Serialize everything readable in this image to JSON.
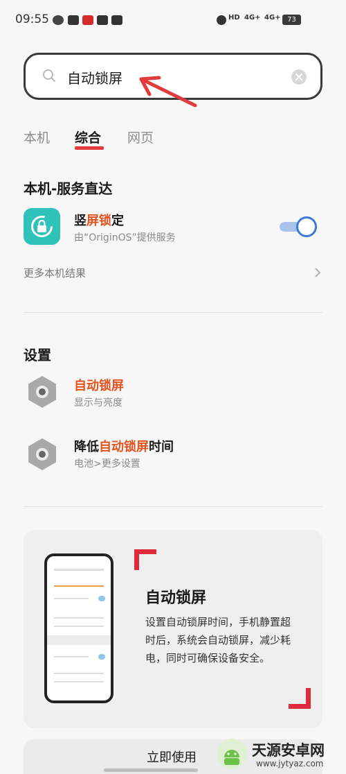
{
  "status": {
    "time": "09:55",
    "signal1": "4G+",
    "signal2": "4G+",
    "battery": "73",
    "hd": "HD"
  },
  "search": {
    "query": "自动锁屏"
  },
  "tabs": [
    {
      "label": "本机"
    },
    {
      "label": "综合"
    },
    {
      "label": "网页"
    }
  ],
  "local_services": {
    "title": "本机-服务直达",
    "item": {
      "title_pre": "竖",
      "title_hl1": "屏锁",
      "title_post": "定",
      "subtitle": "由“OriginOS”提供服务",
      "toggle_on": true
    },
    "more_label": "更多本机结果"
  },
  "settings": {
    "title": "设置",
    "items": [
      {
        "title_pre": "",
        "title_hl": "自动锁屏",
        "title_post": "",
        "subtitle": "显示与亮度"
      },
      {
        "title_pre": "降低",
        "title_hl": "自动锁屏",
        "title_post": "时间",
        "subtitle": "电池>更多设置"
      }
    ]
  },
  "feature_card": {
    "title": "自动锁屏",
    "description": "设置自动锁屏时间，手机静置超时后，系统会自动锁屏，减少耗电，同时可确保设备安全。",
    "action_label": "立即使用"
  },
  "watermark": {
    "name": "天源安卓网",
    "url": "www.jytyaz.com"
  },
  "colors": {
    "accent": "#e23b3b",
    "highlight": "#e2531f",
    "toggle": "#3d7ad6",
    "app_icon": "#2ec2b8"
  }
}
